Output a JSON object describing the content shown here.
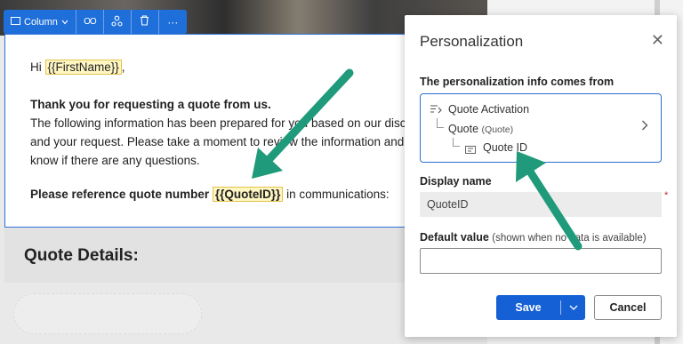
{
  "toolbar": {
    "column_label": "Column",
    "column_icon": "column-layout-icon",
    "icons": [
      "link-icon",
      "personalize-icon",
      "delete-icon",
      "more-icon"
    ],
    "link_glyph": "OO",
    "more_glyph": "···"
  },
  "email": {
    "greeting_prefix": "Hi ",
    "greeting_token": "{{FirstName}}",
    "greeting_suffix": ",",
    "heading": "Thank you for requesting a quote from us.",
    "body_line1": "The following information has been prepared for you based on our disc",
    "body_line2": "and your request. Please take a moment to review the information and",
    "body_line3": "know if there are any questions.",
    "ref_prefix": "Please reference quote number ",
    "ref_token": "{{QuoteID}}",
    "ref_suffix": " in communications:",
    "details_title": "Quote Details:"
  },
  "panel": {
    "title": "Personalization",
    "close_glyph": "✕",
    "source_label": "The personalization info comes from",
    "source": {
      "trigger": "Quote Activation",
      "entity": "Quote",
      "entity_note": "(Quote)",
      "field": "Quote ID"
    },
    "display_name_label": "Display name",
    "required_marker": "*",
    "display_name_value": "QuoteID",
    "default_value_label": "Default value",
    "default_value_note": "(shown when no data is available)",
    "default_value": "",
    "save_label": "Save",
    "cancel_label": "Cancel"
  },
  "colors": {
    "accent": "#1560d4",
    "arrow": "#1f9a7a",
    "token_bg": "#fff6c2"
  }
}
